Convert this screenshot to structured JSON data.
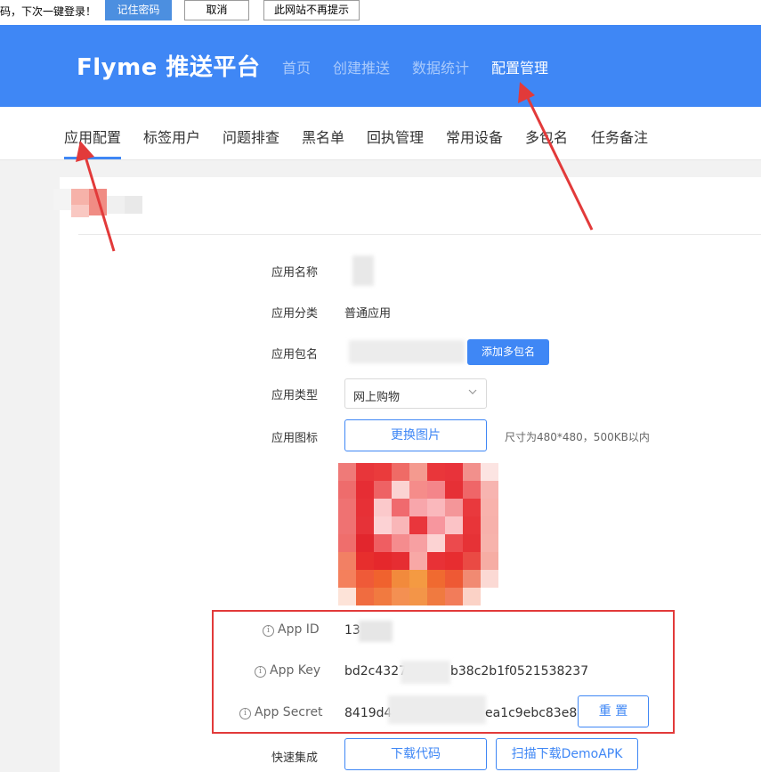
{
  "password_bar": {
    "message": "码，下次一键登录！",
    "remember_button": "记住密码",
    "cancel_button": "取消",
    "never_button": "此网站不再提示"
  },
  "header": {
    "logo": "Flyme 推送平台",
    "nav": [
      "首页",
      "创建推送",
      "数据统计",
      "配置管理"
    ],
    "active_nav": "配置管理"
  },
  "subnav": {
    "tabs": [
      "应用配置",
      "标签用户",
      "问题排查",
      "黑名单",
      "回执管理",
      "常用设备",
      "多包名",
      "任务备注"
    ],
    "active_tab": "应用配置"
  },
  "form": {
    "app_name_label": "应用名称",
    "app_category_label": "应用分类",
    "app_category_value": "普通应用",
    "package_label": "应用包名",
    "add_package_button": "添加多包名",
    "app_type_label": "应用类型",
    "app_type_value": "网上购物",
    "app_icon_label": "应用图标",
    "change_image_button": "更换图片",
    "icon_hint": "尺寸为480*480，500KB以内",
    "app_id_label": "App ID",
    "app_id_value": "13",
    "app_key_label": "App Key",
    "app_key_value_start": "bd2c4327",
    "app_key_value_end": "b38c2b1f0521538237",
    "app_secret_label": "App Secret",
    "app_secret_value_start": "8419d4",
    "app_secret_value_end": "ea1c9ebc83e8",
    "reset_button": "重 置",
    "quick_integration_label": "快速集成",
    "download_code_button": "下载代码",
    "scan_download_button": "扫描下载DemoAPK"
  },
  "colors": {
    "header_blue": "#3f87f5",
    "annotation_red": "#e23a3a"
  }
}
